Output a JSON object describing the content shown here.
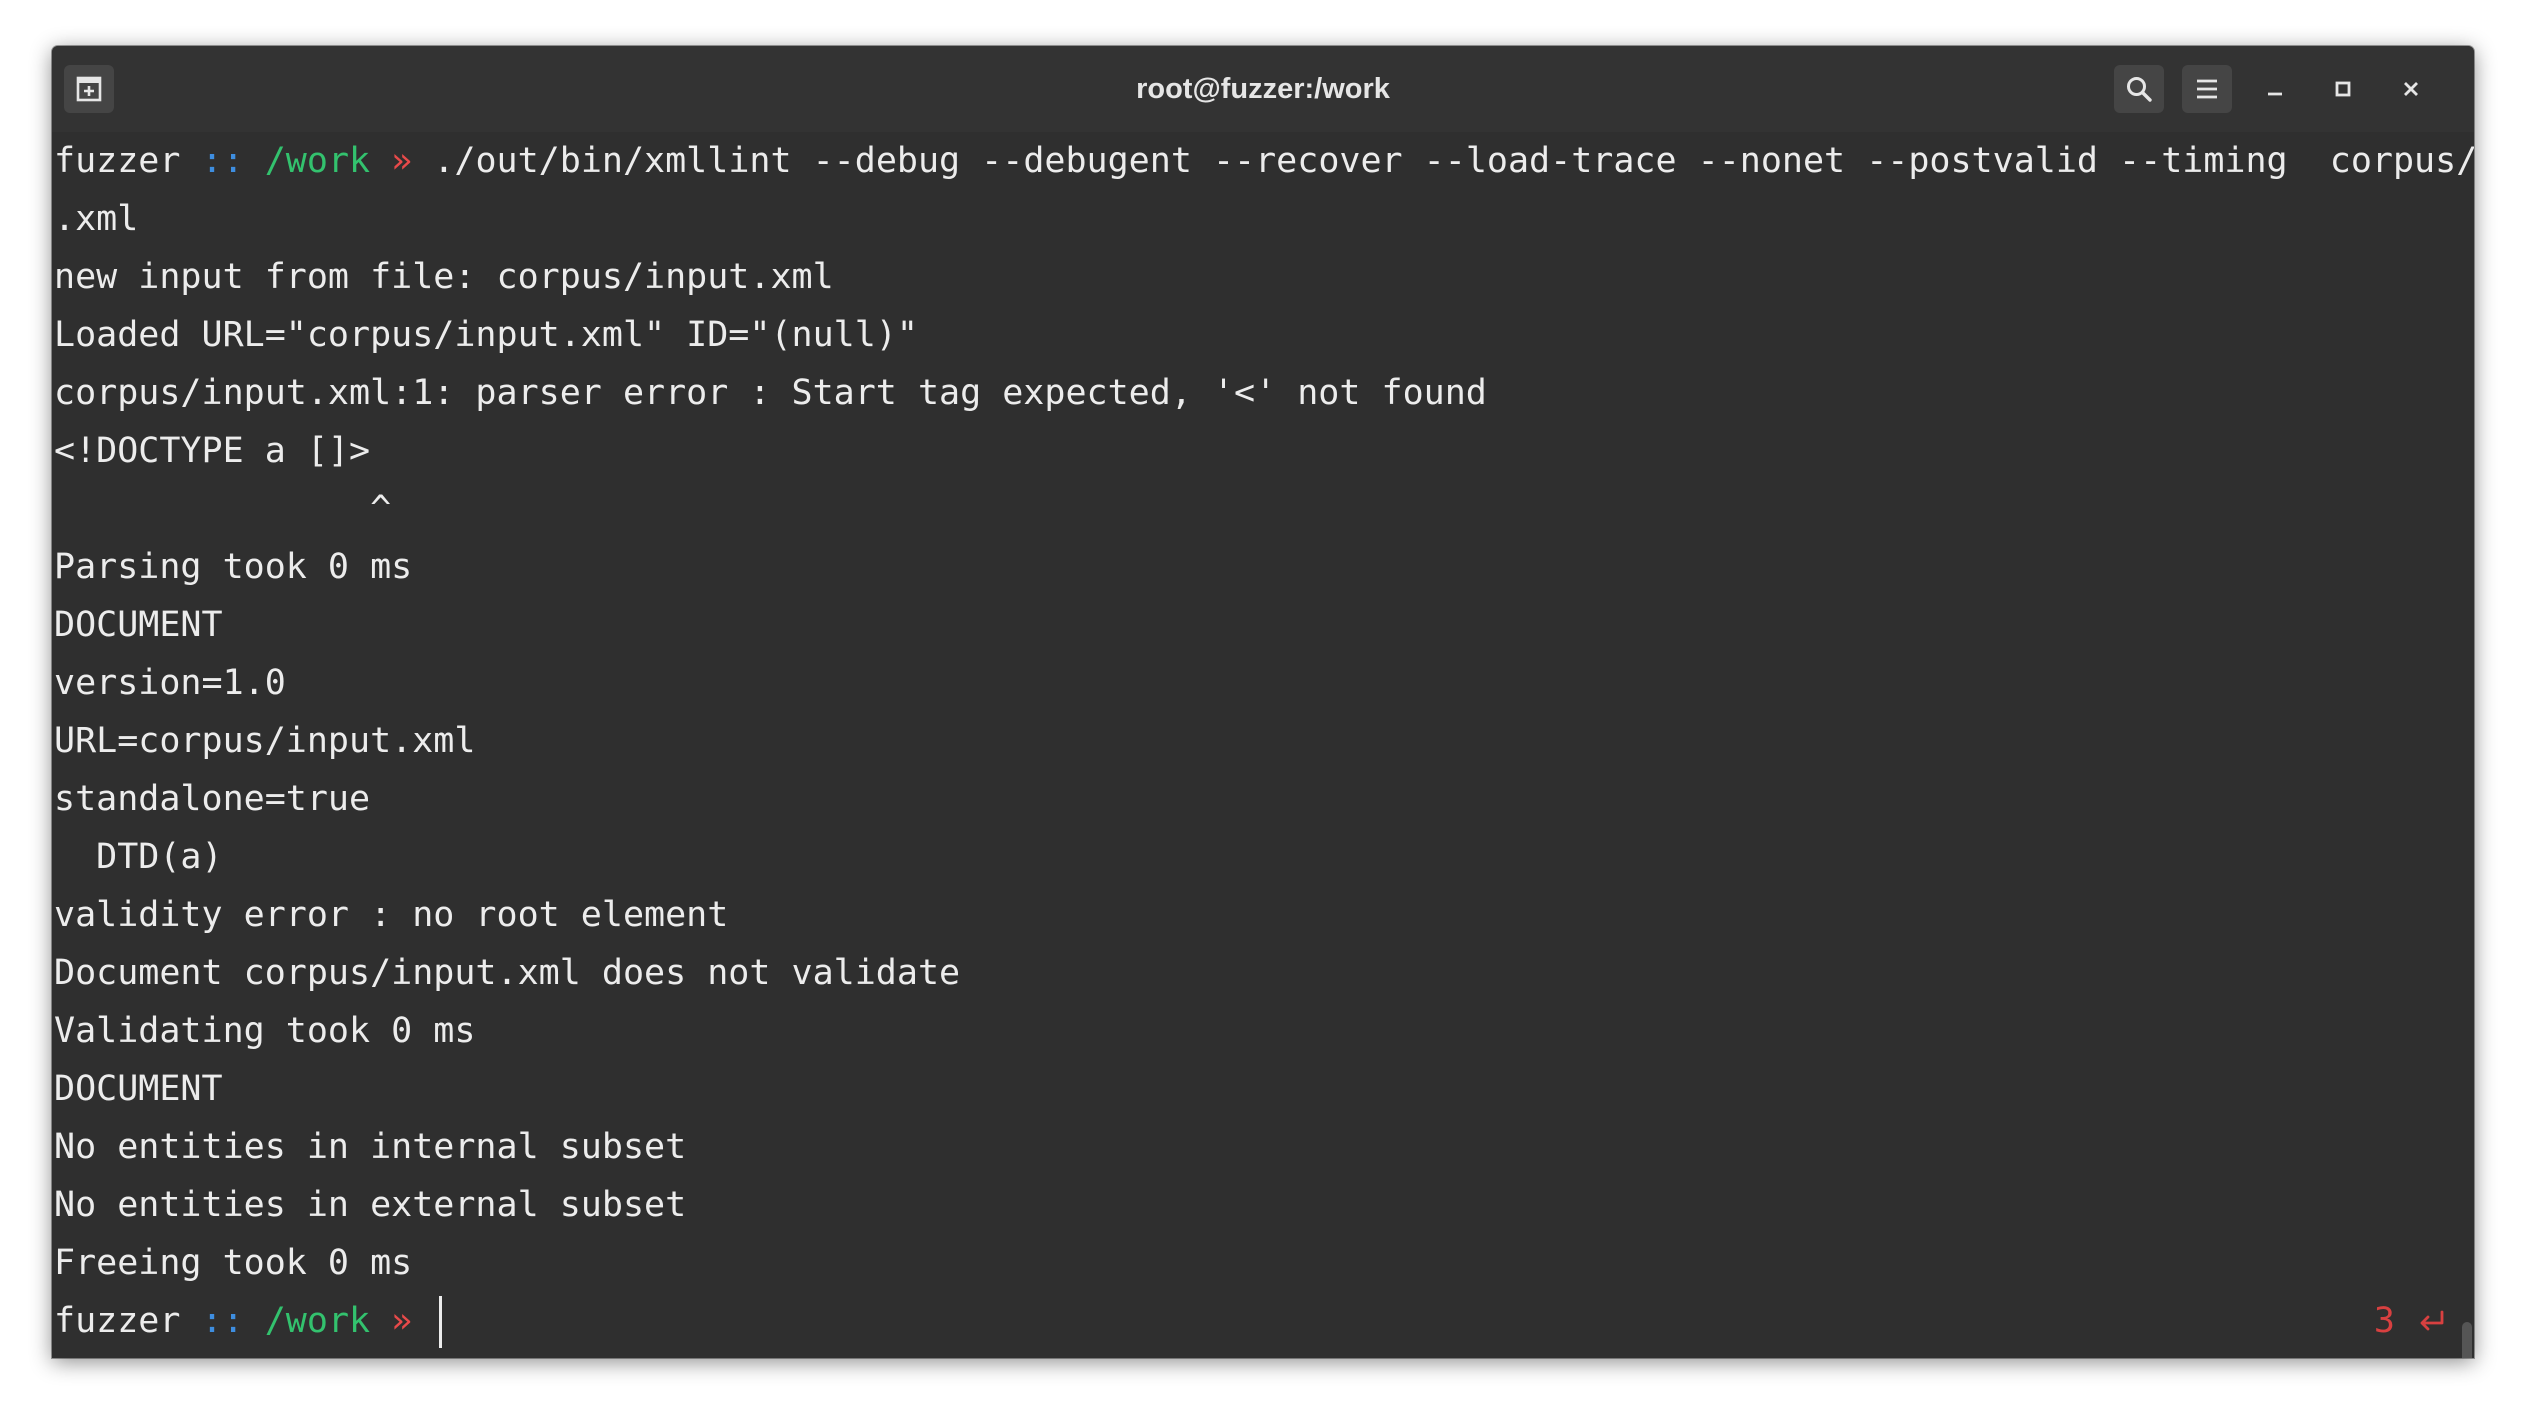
{
  "window": {
    "title": "root@fuzzer:/work"
  },
  "titlebar": {
    "new_tab_icon": "new-tab-icon",
    "search_icon": "search-icon",
    "menu_icon": "hamburger-menu-icon",
    "minimize_icon": "minimize-icon",
    "maximize_icon": "maximize-icon",
    "close_icon": "close-icon"
  },
  "prompt": {
    "user": "fuzzer",
    "sep": " :: ",
    "dir": "/work",
    "arrow": " » "
  },
  "command": "./out/bin/xmllint --debug --debugent --recover --load-trace --nonet --postvalid --timing  corpus/input",
  "output": [
    ".xml",
    "new input from file: corpus/input.xml",
    "Loaded URL=\"corpus/input.xml\" ID=\"(null)\"",
    "corpus/input.xml:1: parser error : Start tag expected, '<' not found",
    "<!DOCTYPE a []>",
    "               ^",
    "Parsing took 0 ms",
    "DOCUMENT",
    "version=1.0",
    "URL=corpus/input.xml",
    "standalone=true",
    "  DTD(a)",
    "validity error : no root element",
    "Document corpus/input.xml does not validate",
    "Validating took 0 ms",
    "DOCUMENT",
    "No entities in internal subset",
    "No entities in external subset",
    "Freeing took 0 ms"
  ],
  "exit_status": {
    "code": "3",
    "icon": "return-arrow-icon"
  },
  "colors": {
    "prompt_sep": "#3e8ee0",
    "prompt_dir": "#33c26e",
    "prompt_arrow": "#e84a4a",
    "exit_status": "#d84040",
    "background": "#2f2f2f"
  }
}
